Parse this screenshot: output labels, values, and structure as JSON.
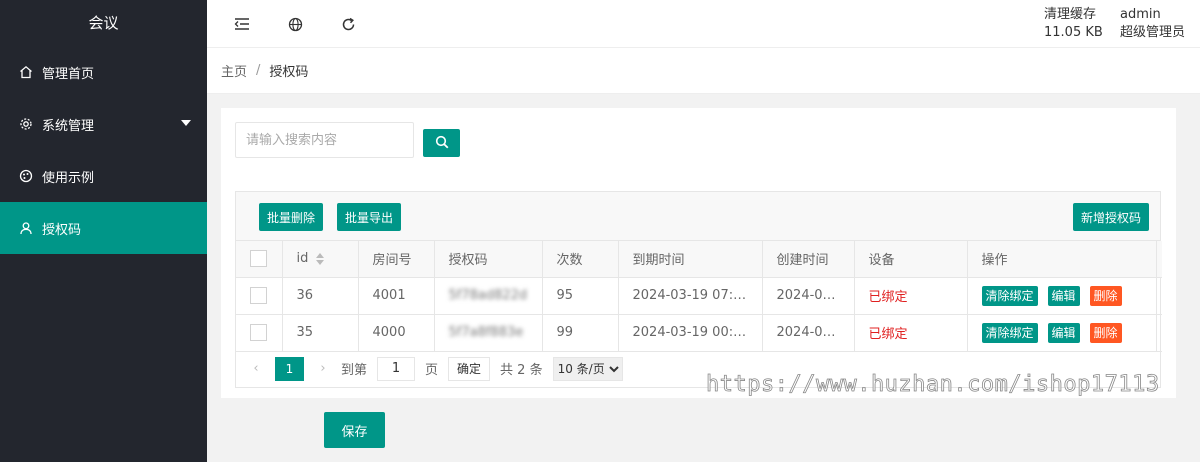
{
  "app": {
    "logo": "会议"
  },
  "sidebar": {
    "items": [
      {
        "label": "管理首页",
        "icon": "home-icon"
      },
      {
        "label": "系统管理",
        "icon": "gear-icon"
      },
      {
        "label": "使用示例",
        "icon": "palette-icon"
      },
      {
        "label": "授权码",
        "icon": "user-icon"
      }
    ]
  },
  "header": {
    "cache_label": "清理缓存",
    "cache_size": "11.05 KB",
    "username": "admin",
    "role": "超级管理员"
  },
  "breadcrumb": {
    "home": "主页",
    "separator": "/",
    "current": "授权码"
  },
  "search": {
    "placeholder": "请输入搜索内容",
    "value": ""
  },
  "toolbar": {
    "batch_delete": "批量删除",
    "batch_export": "批量导出",
    "add_code": "新增授权码"
  },
  "table": {
    "headers": [
      "id",
      "房间号",
      "授权码",
      "次数",
      "到期时间",
      "创建时间",
      "设备",
      "操作"
    ],
    "rows": [
      {
        "id": "36",
        "room": "4001",
        "code": "5f78ad822d",
        "count": "95",
        "expire": "2024-03-19 07:4...",
        "created": "2024-03...",
        "device": "已绑定"
      },
      {
        "id": "35",
        "room": "4000",
        "code": "5f7a8f883e",
        "count": "99",
        "expire": "2024-03-19 00:0...",
        "created": "2024-03...",
        "device": "已绑定"
      }
    ],
    "actions": {
      "unbind": "清除绑定",
      "edit": "编辑",
      "delete": "删除"
    }
  },
  "pager": {
    "current_page": "1",
    "goto_label": "到第",
    "goto_value": "1",
    "page_unit": "页",
    "confirm": "确定",
    "total": "共 2 条",
    "page_size": "10 条/页"
  },
  "form": {
    "save": "保存"
  },
  "watermark": "https://www.huzhan.com/ishop17113",
  "colors": {
    "primary": "#009688",
    "sidebar": "#23262e",
    "danger": "#ff5722",
    "bound_text": "#e02020"
  }
}
